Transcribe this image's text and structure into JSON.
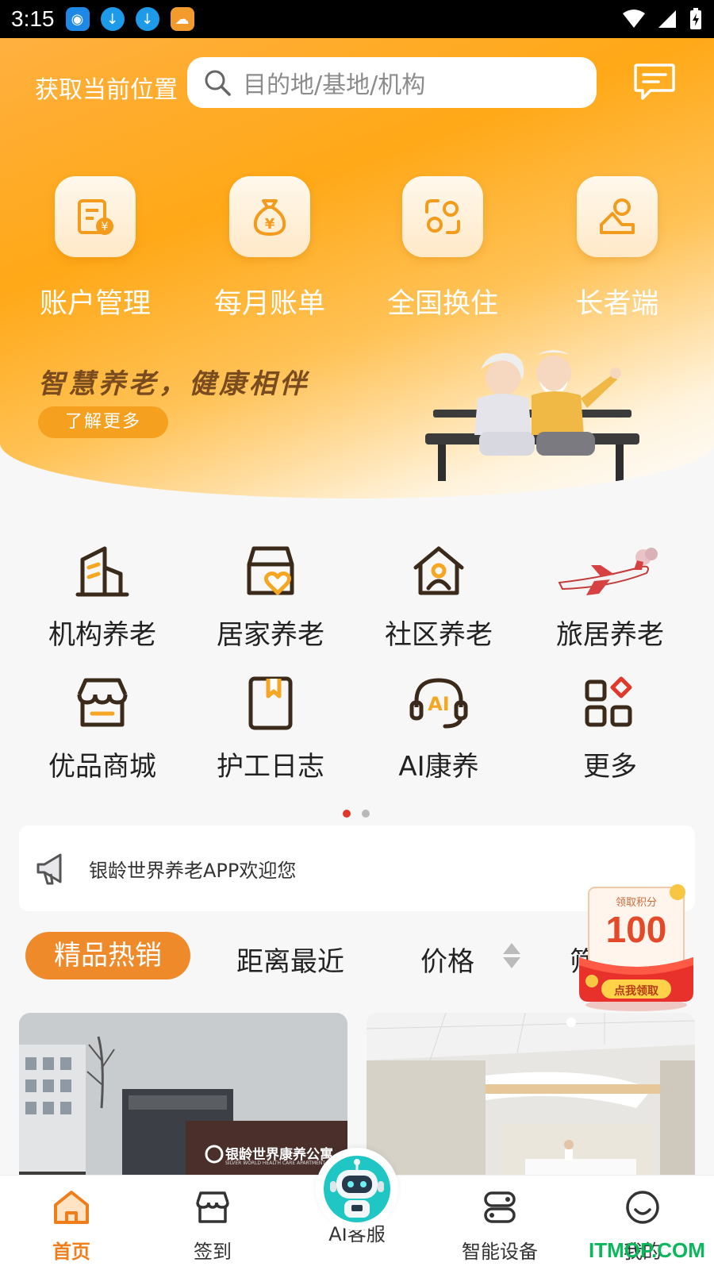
{
  "status_bar": {
    "time": "3:15"
  },
  "header": {
    "location_label": "获取当前位置",
    "search_placeholder": "目的地/基地/机构"
  },
  "quick_actions": [
    {
      "label": "账户管理",
      "icon": "account-bill-icon"
    },
    {
      "label": "每月账单",
      "icon": "money-bag-icon"
    },
    {
      "label": "全国换住",
      "icon": "swap-icon"
    },
    {
      "label": "长者端",
      "icon": "elder-user-icon"
    }
  ],
  "banner": {
    "slogan": "智慧养老，健康相伴",
    "cta": "了解更多"
  },
  "services": [
    {
      "label": "机构养老",
      "icon": "building-icon"
    },
    {
      "label": "居家养老",
      "icon": "home-heart-icon"
    },
    {
      "label": "社区养老",
      "icon": "community-icon"
    },
    {
      "label": "旅居养老",
      "icon": "airplane-icon"
    },
    {
      "label": "优品商城",
      "icon": "store-icon"
    },
    {
      "label": "护工日志",
      "icon": "diary-icon"
    },
    {
      "label": "AI康养",
      "icon": "ai-headset-icon"
    },
    {
      "label": "更多",
      "icon": "grid-more-icon"
    }
  ],
  "pager": {
    "pages": 2,
    "current": 1
  },
  "notice": {
    "text": "银龄世界养老APP欢迎您"
  },
  "filters": {
    "active": "精品热销",
    "distance": "距离最近",
    "price": "价格",
    "partial": "筛"
  },
  "coupon": {
    "top_text": "领取积分",
    "value": "100",
    "button": "点我领取"
  },
  "cards": [
    {
      "sign_text": "银龄世界康养公寓",
      "sign_sub": "SILVER WORLD HEALTH CARE APARTMENT"
    },
    {
      "sign_text": ""
    }
  ],
  "bottom_nav": [
    {
      "label": "首页",
      "icon": "home-icon",
      "active": true
    },
    {
      "label": "签到",
      "icon": "store-checkin-icon",
      "active": false
    },
    {
      "label": "AI客服",
      "icon": "robot-icon",
      "active": false
    },
    {
      "label": "智能设备",
      "icon": "device-icon",
      "active": false
    },
    {
      "label": "我的",
      "icon": "smile-profile-icon",
      "active": false
    }
  ],
  "watermark": "ITMOP.COM",
  "colors": {
    "brand_orange": "#ffa817",
    "accent": "#ef8a2a",
    "icon_brown": "#3b2a1a",
    "active_nav": "#ef7d1a"
  }
}
